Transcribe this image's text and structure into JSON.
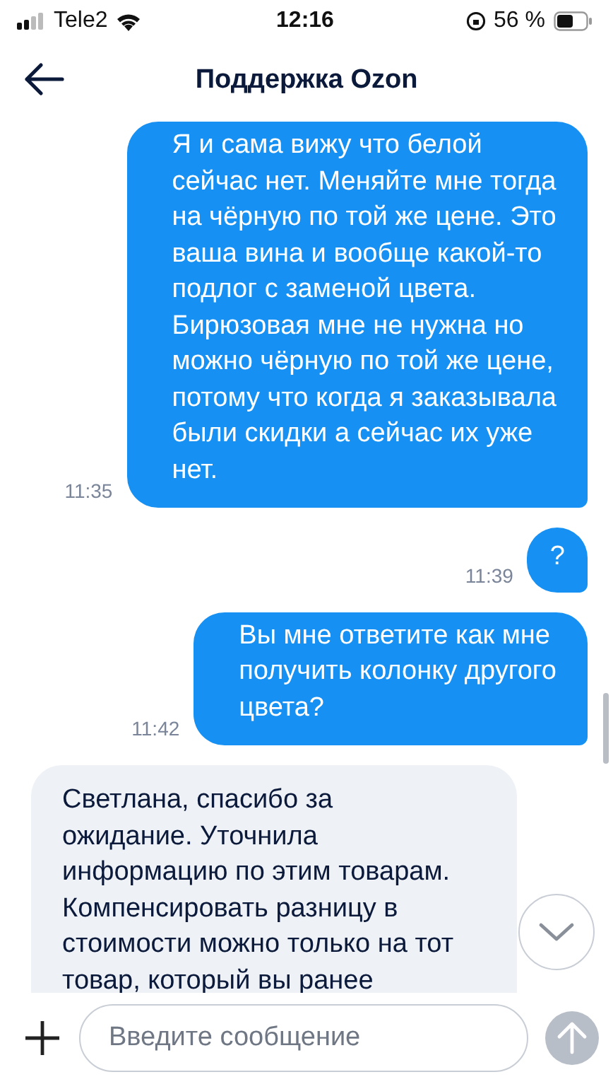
{
  "status_bar": {
    "carrier": "Tele2",
    "time": "12:16",
    "battery": "56 %"
  },
  "header": {
    "title": "Поддержка Ozon"
  },
  "messages": [
    {
      "kind": "outgoing",
      "text": "Я и сама вижу что белой\nсейчас нет. Меняйте мне тогда\nна чёрную по той же цене. Это\nваша вина и вообще какой-то\nподлог с заменой цвета.\nБирюзовая мне не нужна но\nможно чёрную по той же цене,\nпотому что когда я заказывала\nбыли скидки а сейчас их уже\nнет.",
      "time": "11:35"
    },
    {
      "kind": "outgoing",
      "text": "?",
      "time": "11:39"
    },
    {
      "kind": "outgoing",
      "text": "Вы мне ответите как мне\nполучить колонку другого\nцвета?",
      "time": "11:42"
    },
    {
      "kind": "incoming",
      "text": "Светлана, спасибо за\nожидание. Уточнила\nинформацию по этим товарам.\nКомпенсировать разницу в\nстоимости можно только на тот\nтовар, который вы ранее"
    }
  ],
  "composer": {
    "placeholder": "Введите сообщение"
  }
}
